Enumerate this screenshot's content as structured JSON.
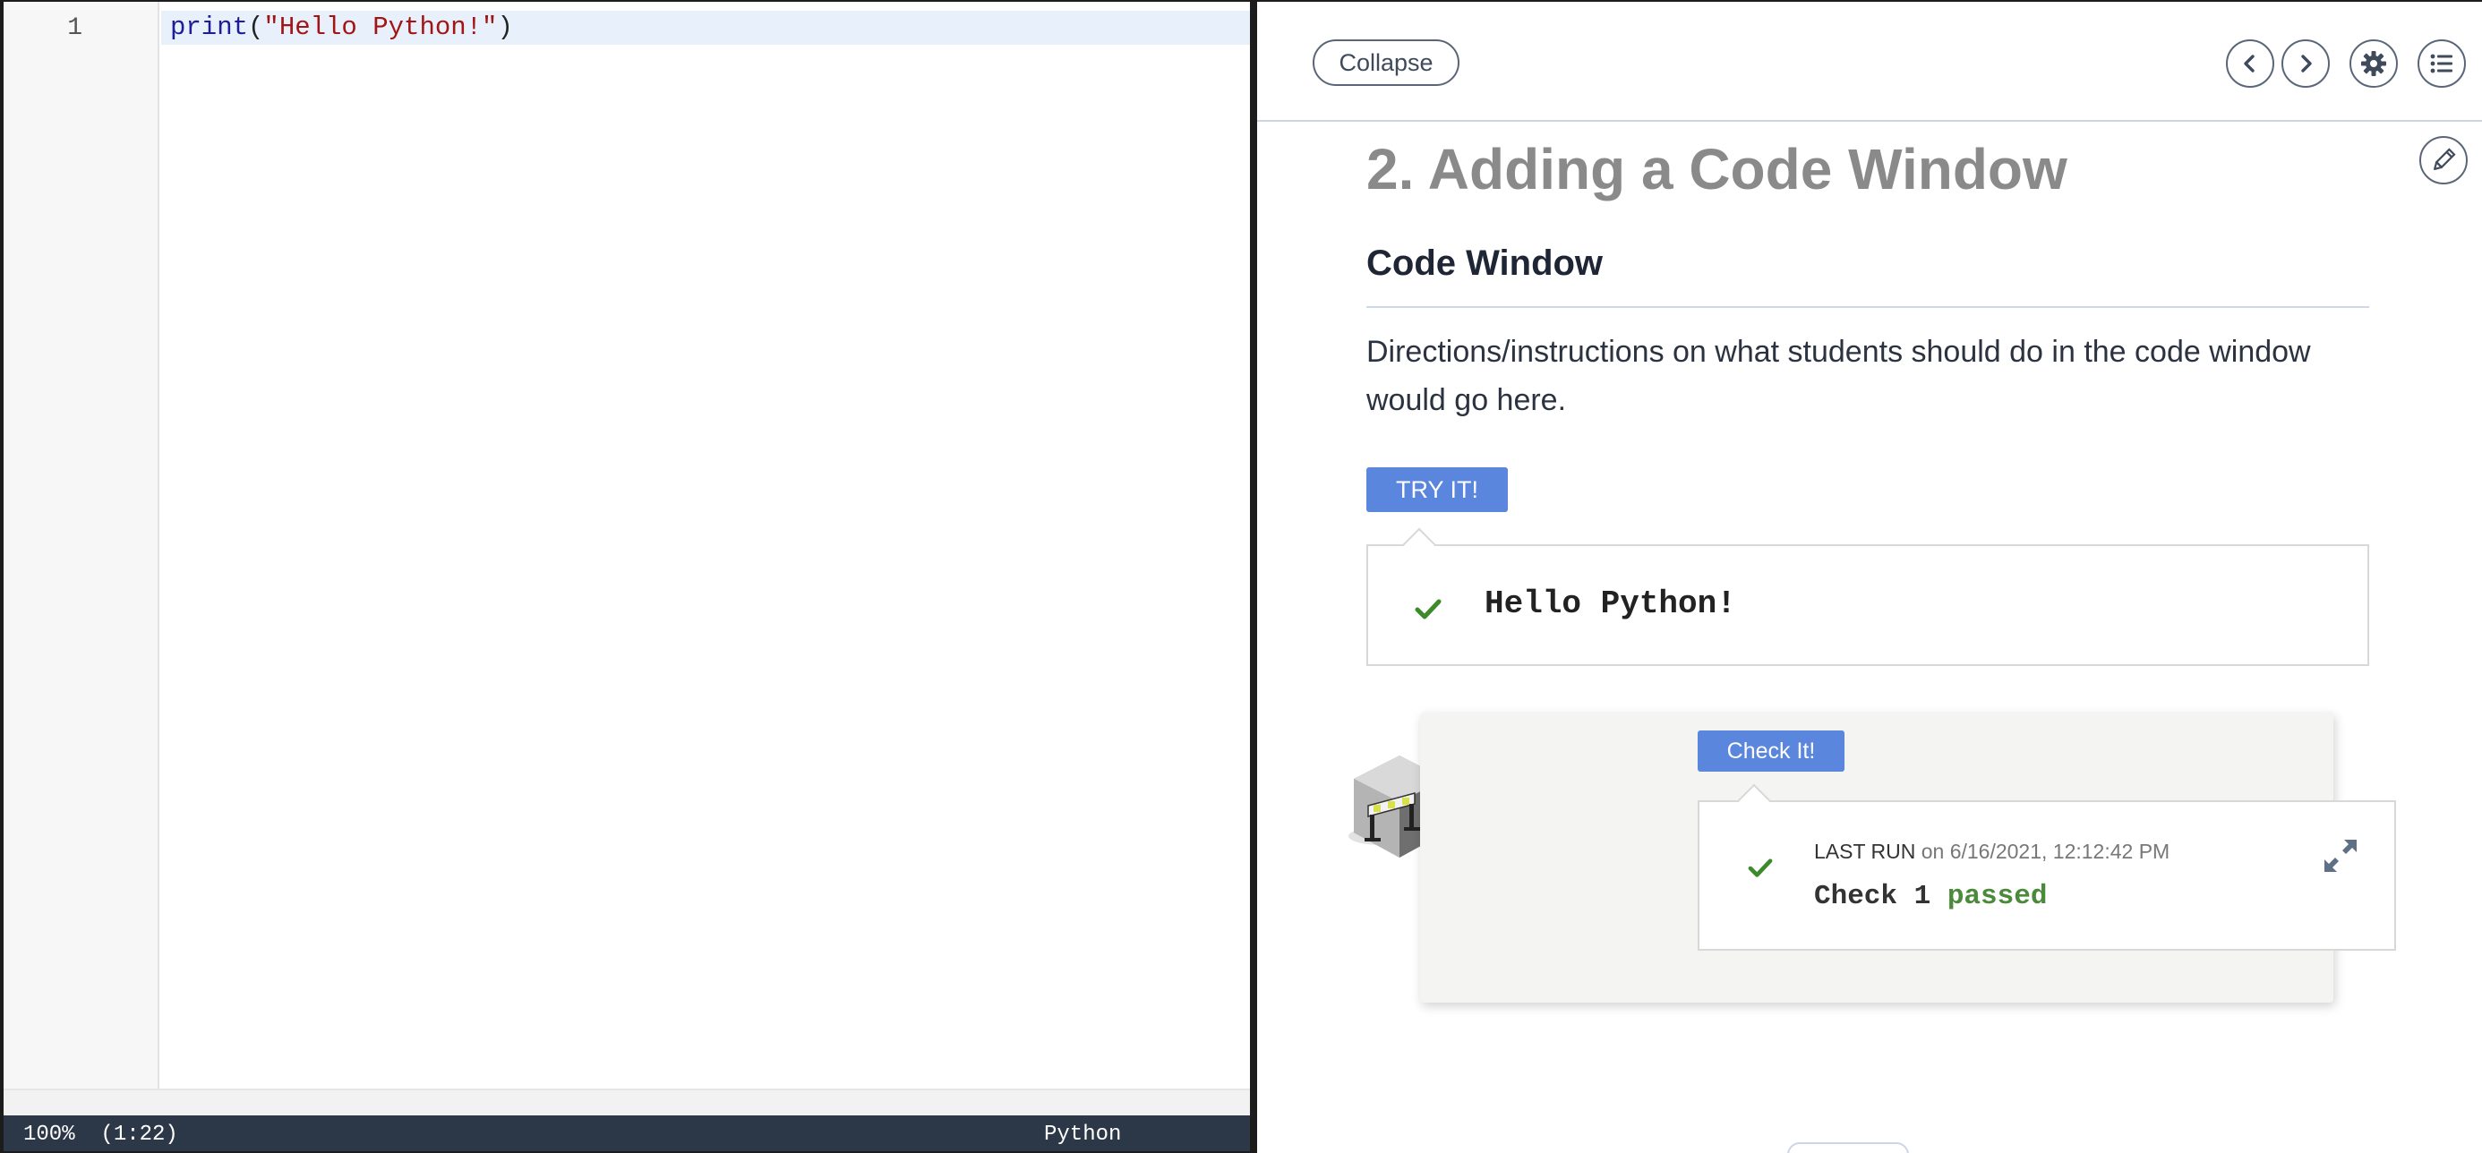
{
  "editor": {
    "line_numbers": [
      "1"
    ],
    "code": {
      "builtin": "print",
      "open_paren": "(",
      "string": "\"Hello Python!\"",
      "close_paren": ")"
    },
    "status": {
      "position": "100%  (1:22)",
      "language": "Python"
    }
  },
  "guide": {
    "toolbar": {
      "collapse_label": "Collapse",
      "icons": [
        "chevron-left-icon",
        "chevron-right-icon",
        "gear-icon",
        "list-icon",
        "pencil-icon"
      ]
    },
    "page_title": "2. Adding a Code Window",
    "section_heading": "Code Window",
    "directions": "Directions/instructions on what students should do in the code window would go here.",
    "try_it_label": "TRY IT!",
    "output_text": "Hello Python!",
    "check": {
      "button_label": "Check It!",
      "last_run_label": "LAST RUN",
      "last_run_time": "on 6/16/2021, 12:12:42 PM",
      "summary_prefix": "Check 1 ",
      "summary_status": "passed"
    }
  },
  "colors": {
    "accent_button": "#5b86de",
    "success_green": "#4a8a3a",
    "status_bar": "#2c3747",
    "title_gray": "#8a8a8a"
  }
}
